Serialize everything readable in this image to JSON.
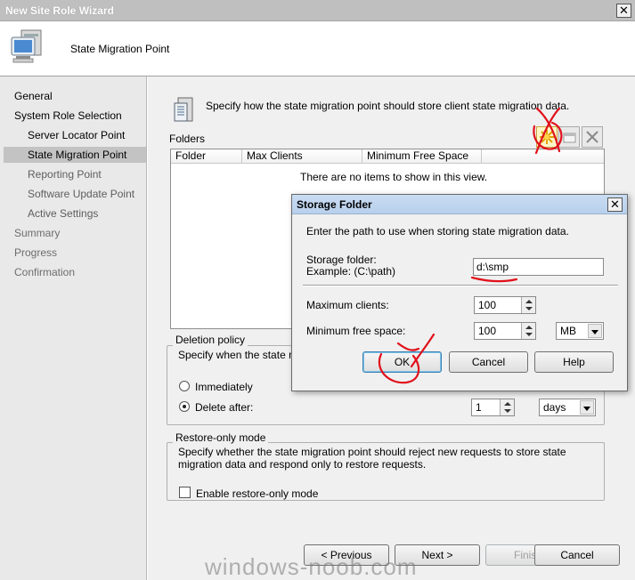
{
  "window": {
    "title": "New Site Role Wizard",
    "close_glyph": "✕"
  },
  "header": {
    "title": "State Migration Point",
    "icon": "computer-monitor-icon"
  },
  "nav": [
    {
      "label": "General",
      "state": "normal"
    },
    {
      "label": "System Role Selection",
      "state": "normal"
    },
    {
      "label": "Server Locator Point",
      "state": "sub"
    },
    {
      "label": "State Migration Point",
      "state": "selected"
    },
    {
      "label": "Reporting Point",
      "state": "sub-gray"
    },
    {
      "label": "Software Update Point",
      "state": "sub-gray"
    },
    {
      "label": "Active Settings",
      "state": "sub-gray"
    },
    {
      "label": "Summary",
      "state": "gray"
    },
    {
      "label": "Progress",
      "state": "gray"
    },
    {
      "label": "Confirmation",
      "state": "gray"
    }
  ],
  "main": {
    "instruction": "Specify how the state migration point should store client state migration data.",
    "folders_label": "Folders",
    "columns": [
      "Folder",
      "Max Clients",
      "Minimum Free Space"
    ],
    "empty_text": "There are no items to show in this view.",
    "toolbar": {
      "new": "new-star-icon",
      "properties": "properties-icon",
      "delete": "delete-x-icon"
    },
    "deletion": {
      "title": "Deletion policy",
      "desc": "Specify when the state mig",
      "immediately": "Immediately",
      "delete_after": "Delete after:",
      "delete_after_value": "1",
      "unit": "days",
      "selected": "delete_after"
    },
    "restore": {
      "title": "Restore-only mode",
      "desc": "Specify whether the state migration point should reject new requests to store state migration data and respond only to restore requests.",
      "checkbox": "Enable restore-only mode",
      "checked": false
    },
    "buttons": {
      "previous": "< Previous",
      "next": "Next >",
      "finish": "Finish",
      "cancel": "Cancel"
    }
  },
  "dialog": {
    "title": "Storage Folder",
    "close_glyph": "✕",
    "prompt": "Enter the path to use when storing state migration data.",
    "folder_label": "Storage folder:",
    "folder_example": "Example: (C:\\path)",
    "folder_value": "d:\\smp",
    "max_clients_label": "Maximum clients:",
    "max_clients_value": "100",
    "min_free_label": "Minimum free space:",
    "min_free_value": "100",
    "min_free_unit": "MB",
    "ok": "OK",
    "cancel": "Cancel",
    "help": "Help"
  },
  "watermark": "windows-noob.com",
  "colors": {
    "annotation": "#e0101a",
    "dialog_title": "#bcd2ee",
    "selection": "#c3c3c3"
  }
}
